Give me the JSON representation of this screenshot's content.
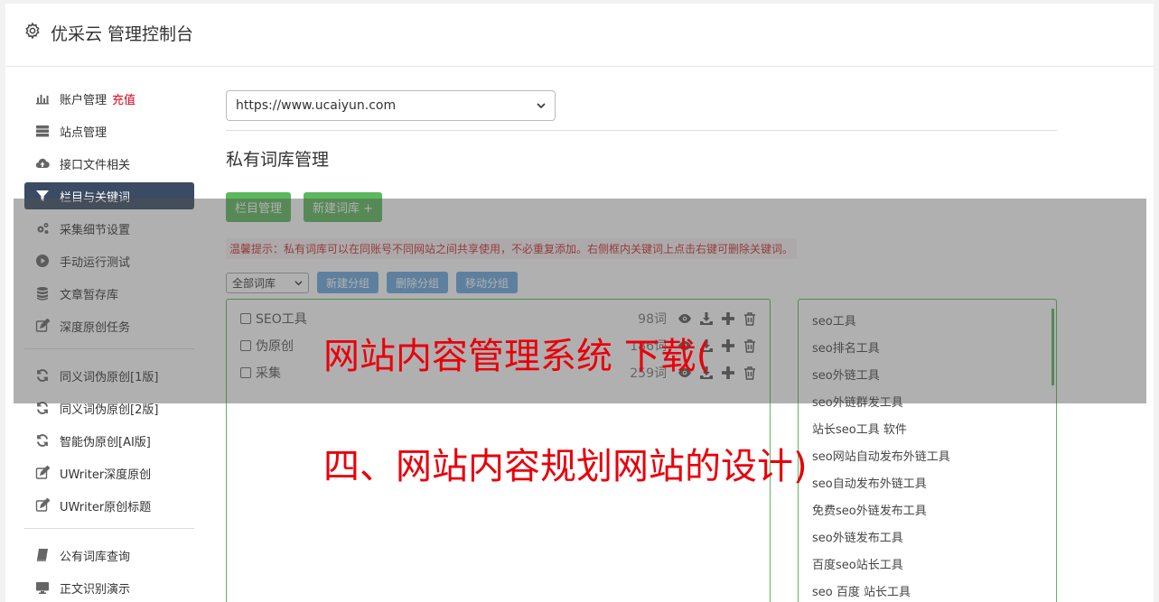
{
  "header": {
    "title": "优采云 管理控制台"
  },
  "sidebar": {
    "group1": [
      {
        "label": "账户管理",
        "icon": "bar-chart-icon",
        "extra": "充值",
        "active": false
      },
      {
        "label": "站点管理",
        "icon": "server-icon",
        "active": false
      },
      {
        "label": "接口文件相关",
        "icon": "cloud-upload-icon",
        "active": false
      },
      {
        "label": "栏目与关键词",
        "icon": "filter-icon",
        "active": true
      },
      {
        "label": "采集细节设置",
        "icon": "cogs-icon",
        "active": false
      },
      {
        "label": "手动运行测试",
        "icon": "play-icon",
        "active": false
      },
      {
        "label": "文章暂存库",
        "icon": "database-icon",
        "active": false
      },
      {
        "label": "深度原创任务",
        "icon": "edit-icon",
        "active": false
      }
    ],
    "group2": [
      {
        "label": "同义词伪原创[1版]",
        "icon": "refresh-icon"
      },
      {
        "label": "同义词伪原创[2版]",
        "icon": "refresh-icon"
      },
      {
        "label": "智能伪原创[AI版]",
        "icon": "refresh-icon"
      },
      {
        "label": "UWriter深度原创",
        "icon": "edit-icon"
      },
      {
        "label": "UWriter原创标题",
        "icon": "edit-icon"
      }
    ],
    "group3": [
      {
        "label": "公有词库查询",
        "icon": "book-icon"
      },
      {
        "label": "正文识别演示",
        "icon": "monitor-icon"
      }
    ]
  },
  "main": {
    "site_select": "https://www.ucaiyun.com",
    "section_title": "私有词库管理",
    "btn_column": "栏目管理",
    "btn_new_lib": "新建词库 +",
    "tip": "温馨提示：私有词库可以在同账号不同网站之间共享使用，不必重复添加。右侧框内关键词上点击右键可删除关键词。",
    "filter_select": "全部词库",
    "btn_new_group": "新建分组",
    "btn_delete_group": "删除分组",
    "btn_move_group": "移动分组",
    "libraries": [
      {
        "name": "SEO工具",
        "count": "98词"
      },
      {
        "name": "伪原创",
        "count": "186词"
      },
      {
        "name": "采集",
        "count": "259词"
      }
    ],
    "keywords": [
      "seo工具",
      "seo排名工具",
      "seo外链工具",
      "seo外链群发工具",
      "站长seo工具 软件",
      "seo网站自动发布外链工具",
      "seo自动发布外链工具",
      "免费seo外链发布工具",
      "seo外链发布工具",
      "百度seo站长工具",
      "seo 百度 站长工具"
    ]
  },
  "overlay": {
    "line1": "网站内容管理系统 下载(",
    "line2": "四、网站内容规划网站的设计)"
  },
  "colors": {
    "accent_green": "#5cb85c",
    "active_nav": "#3b4b63",
    "banner_red": "#e8000b"
  }
}
